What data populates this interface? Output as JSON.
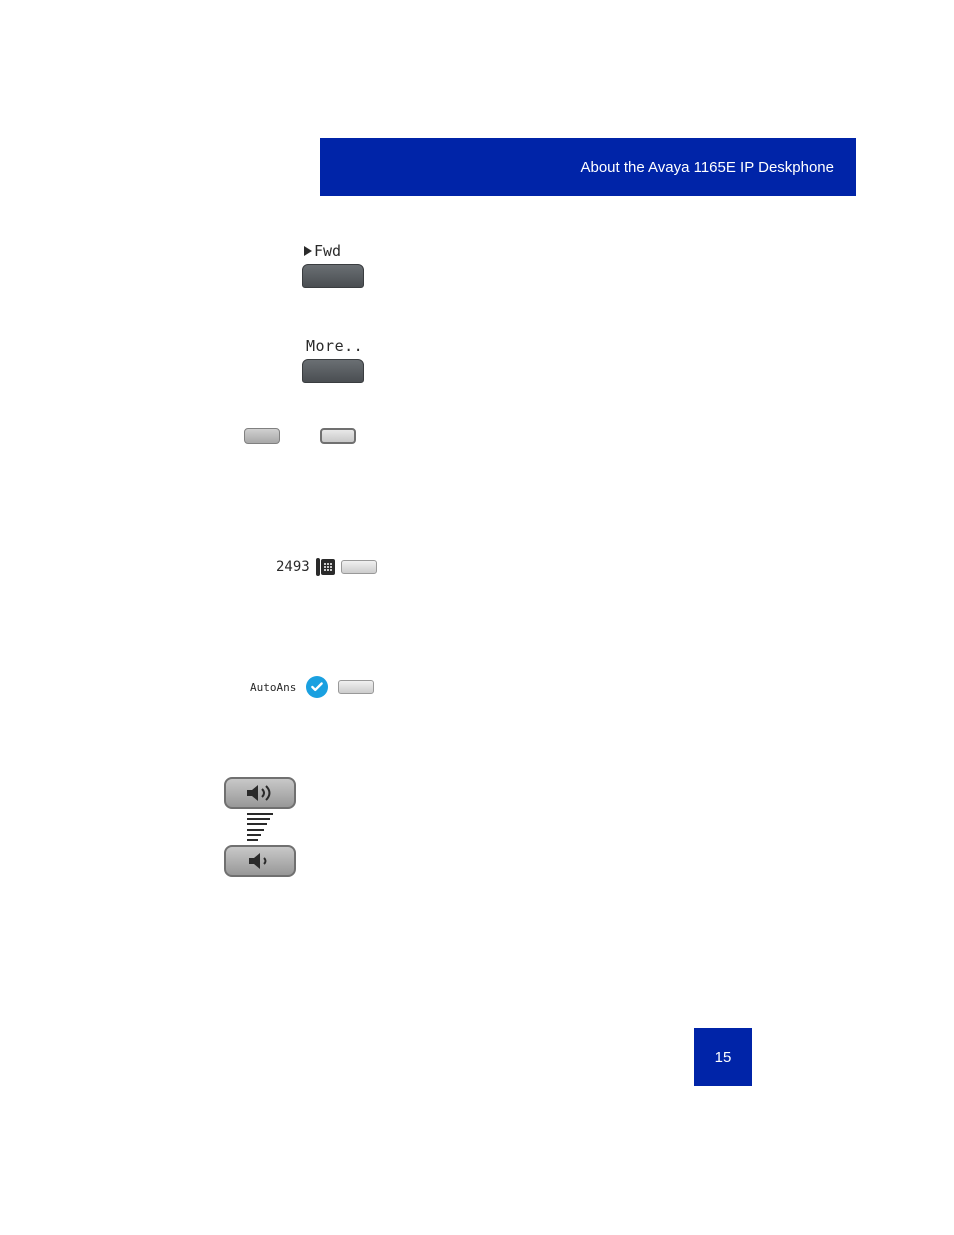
{
  "header": {
    "title": "About the Avaya 1165E IP Deskphone"
  },
  "page": {
    "number": "15"
  },
  "softkeys": {
    "fwd_label": "Fwd",
    "more_label": "More.."
  },
  "line_key": {
    "label": "2493"
  },
  "feature_key": {
    "label": "AutoAns"
  },
  "icons": {
    "triangle": "play-triangle-icon",
    "phone": "phone-icon",
    "check": "checkmark-icon",
    "vol_up": "speaker-loud-icon",
    "vol_down": "speaker-quiet-icon"
  }
}
